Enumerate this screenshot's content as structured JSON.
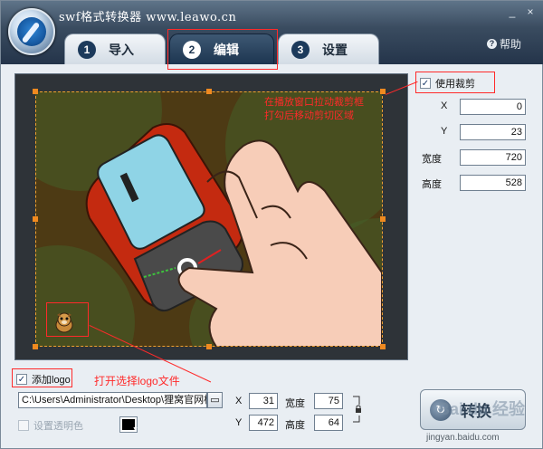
{
  "app": {
    "title": "swf格式转换器 www.leawo.cn"
  },
  "window_controls": {
    "minimize": "_",
    "close": "×"
  },
  "tabs": [
    {
      "num": "1",
      "label": "导入"
    },
    {
      "num": "2",
      "label": "编辑"
    },
    {
      "num": "3",
      "label": "设置"
    }
  ],
  "help": {
    "label": "帮助",
    "icon_char": "?"
  },
  "crop": {
    "enabled_label": "使用裁剪",
    "checked": true,
    "x_label": "X",
    "x_value": "0",
    "y_label": "Y",
    "y_value": "23",
    "width_label": "宽度",
    "width_value": "720",
    "height_label": "高度",
    "height_value": "528"
  },
  "annotations": {
    "crop_note_line1": "在播放窗口拉动裁剪框",
    "crop_note_line2": "打勾后移动剪切区域",
    "logo_note": "打开选择logo文件"
  },
  "logo": {
    "add_label": "添加logo",
    "checked": true,
    "path": "C:\\Users\\Administrator\\Desktop\\狸窝官网标志.p",
    "transparent_label": "设置透明色",
    "transparent_checked": false,
    "transparent_color": "#000000",
    "x_label": "X",
    "x_value": "31",
    "y_label": "Y",
    "y_value": "472",
    "width_label": "宽度",
    "width_value": "75",
    "height_label": "高度",
    "height_value": "64"
  },
  "convert": {
    "label": "转换"
  },
  "watermark": {
    "brand": "Bai du 经验",
    "url": "jingyan.baidu.com"
  },
  "colors": {
    "accent_red": "#ff2a2a",
    "crop_orange": "#f08a20",
    "active_tab": "#1d3550"
  }
}
